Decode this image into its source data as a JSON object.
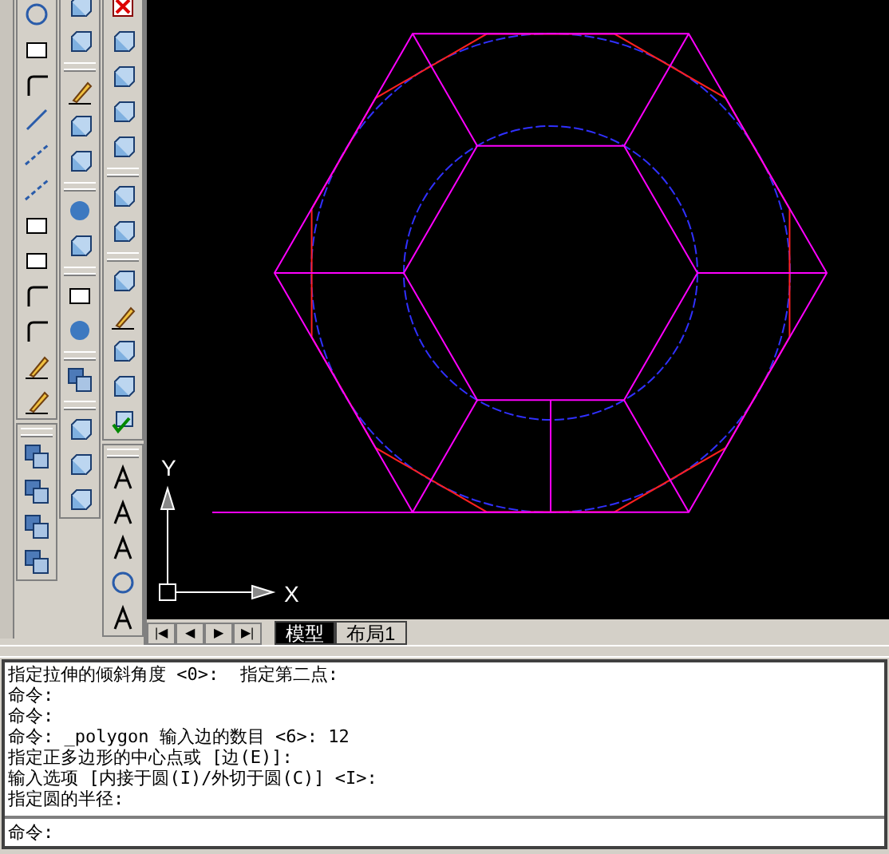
{
  "canvas": {
    "ucs": {
      "x_label": "X",
      "y_label": "Y"
    }
  },
  "layout_nav": [
    "|◀",
    "◀",
    "▶",
    "▶|"
  ],
  "layout_tabs": [
    {
      "label": "模型",
      "selected": true
    },
    {
      "label": "布局1",
      "selected": false
    }
  ],
  "command_history": [
    "指定拉伸的倾斜角度 <0>:  指定第二点:",
    "命令:",
    "命令:",
    "命令: _polygon 输入边的数目 <6>: 12",
    "指定正多边形的中心点或 [边(E)]:",
    "输入选项 [内接于圆(I)/外切于圆(C)] <I>:",
    "指定圆的半径:"
  ],
  "command_prompt": "命令:"
}
